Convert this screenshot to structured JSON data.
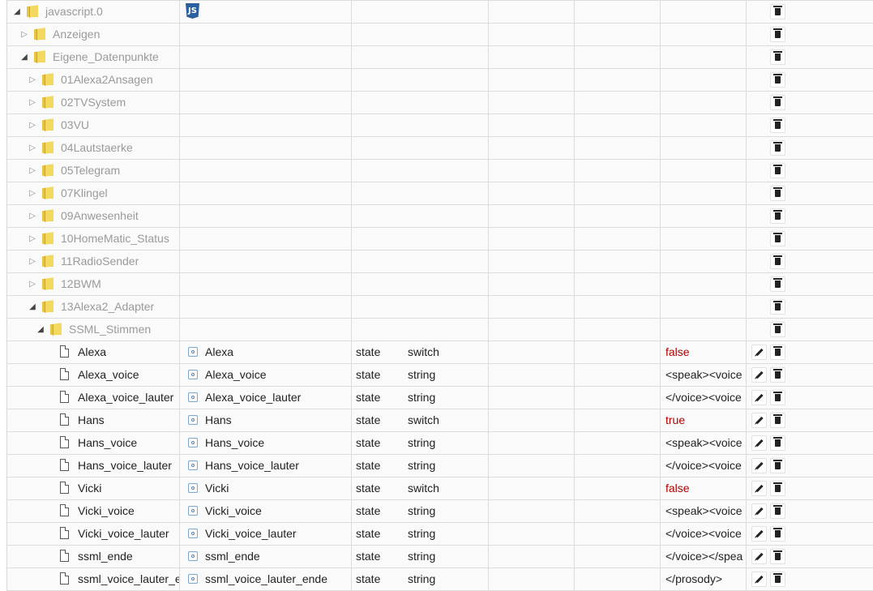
{
  "tree": {
    "root": {
      "label": "javascript.0",
      "icon": "javascript-icon"
    },
    "folders_level1": [
      {
        "label": "Anzeigen",
        "expanded": false
      },
      {
        "label": "Eigene_Datenpunkte",
        "expanded": true
      }
    ],
    "folders_level2": [
      {
        "label": "01Alexa2Ansagen",
        "expanded": false
      },
      {
        "label": "02TVSystem",
        "expanded": false
      },
      {
        "label": "03VU",
        "expanded": false
      },
      {
        "label": "04Lautstaerke",
        "expanded": false
      },
      {
        "label": "05Telegram",
        "expanded": false
      },
      {
        "label": "07Klingel",
        "expanded": false
      },
      {
        "label": "09Anwesenheit",
        "expanded": false
      },
      {
        "label": "10HomeMatic_Status",
        "expanded": false
      },
      {
        "label": "11RadioSender",
        "expanded": false
      },
      {
        "label": "12BWM",
        "expanded": false
      },
      {
        "label": "13Alexa2_Adapter",
        "expanded": true
      }
    ],
    "folder_level3": {
      "label": "SSML_Stimmen",
      "expanded": true
    },
    "states": [
      {
        "id": "Alexa",
        "name": "Alexa",
        "type": "state",
        "role": "switch",
        "value": "false",
        "bool": true
      },
      {
        "id": "Alexa_voice",
        "name": "Alexa_voice",
        "type": "state",
        "role": "string",
        "value": "<speak><voice",
        "bool": false
      },
      {
        "id": "Alexa_voice_lauter",
        "name": "Alexa_voice_lauter",
        "type": "state",
        "role": "string",
        "value": "</voice><voice",
        "bool": false
      },
      {
        "id": "Hans",
        "name": "Hans",
        "type": "state",
        "role": "switch",
        "value": "true",
        "bool": true
      },
      {
        "id": "Hans_voice",
        "name": "Hans_voice",
        "type": "state",
        "role": "string",
        "value": "<speak><voice",
        "bool": false
      },
      {
        "id": "Hans_voice_lauter",
        "name": "Hans_voice_lauter",
        "type": "state",
        "role": "string",
        "value": "</voice><voice",
        "bool": false
      },
      {
        "id": "Vicki",
        "name": "Vicki",
        "type": "state",
        "role": "switch",
        "value": "false",
        "bool": true
      },
      {
        "id": "Vicki_voice",
        "name": "Vicki_voice",
        "type": "state",
        "role": "string",
        "value": "<speak><voice",
        "bool": false
      },
      {
        "id": "Vicki_voice_lauter",
        "name": "Vicki_voice_lauter",
        "type": "state",
        "role": "string",
        "value": "</voice><voice",
        "bool": false
      },
      {
        "id": "ssml_ende",
        "name": "ssml_ende",
        "type": "state",
        "role": "string",
        "value": "</voice></spea",
        "bool": false
      },
      {
        "id": "ssml_voice_lauter_ende",
        "name": "ssml_voice_lauter_ende",
        "type": "state",
        "role": "string",
        "value": "</prosody>",
        "bool": false
      }
    ]
  },
  "colors": {
    "folder": "#f3d95f",
    "bool_value": "#b30000",
    "folder_label": "#9a9a9a"
  }
}
